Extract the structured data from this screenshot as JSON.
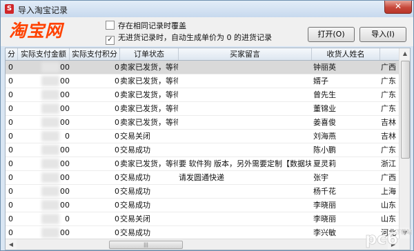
{
  "window": {
    "title": "导入淘宝记录",
    "app_icon": "S",
    "close_glyph": "✕"
  },
  "logo": {
    "text": "淘宝网"
  },
  "options": [
    {
      "label": "存在相同记录时覆盖",
      "checked": false
    },
    {
      "label": "无进货记录时，自动生成单价为 0 的进货记录",
      "checked": true
    }
  ],
  "buttons": {
    "open": "打开(O)",
    "import": "导入(I)"
  },
  "table": {
    "headers": [
      "分",
      "实际支付金额",
      "实际支付积分",
      "订单状态",
      "买家留言",
      "收货人姓名",
      ""
    ],
    "rows": [
      {
        "c0": "0",
        "amount": "00",
        "points": "0",
        "status": "卖家已发货，等待买",
        "message": "",
        "name": "钟丽英",
        "region": "广西",
        "selected": true
      },
      {
        "c0": "0",
        "amount": "00",
        "points": "0",
        "status": "卖家已发货，等待买",
        "message": "",
        "name": "婿子",
        "region": "广东",
        "selected": false
      },
      {
        "c0": "0",
        "amount": "00",
        "points": "0",
        "status": "卖家已发货，等待买",
        "message": "",
        "name": "曾先生",
        "region": "广东",
        "selected": false
      },
      {
        "c0": "0",
        "amount": "00",
        "points": "0",
        "status": "卖家已发货，等待买",
        "message": "",
        "name": "董锦业",
        "region": "广东",
        "selected": false
      },
      {
        "c0": "0",
        "amount": "00",
        "points": "0",
        "status": "卖家已发货，等待买",
        "message": "",
        "name": "姜喜俊",
        "region": "吉林",
        "selected": false
      },
      {
        "c0": "0",
        "amount": "0",
        "points": "0",
        "status": "交易关闭",
        "message": "",
        "name": "刘海燕",
        "region": "吉林",
        "selected": false
      },
      {
        "c0": "0",
        "amount": "00",
        "points": "0",
        "status": "交易成功",
        "message": "",
        "name": "陈小鹏",
        "region": "广东",
        "selected": false
      },
      {
        "c0": "0",
        "amount": "00",
        "points": "0",
        "status": "卖家已发货，等待买",
        "message": "要 软件狗 版本，另外需要定制【数据块",
        "name": "夏灵莉",
        "region": "浙江",
        "selected": false
      },
      {
        "c0": "0",
        "amount": "00",
        "points": "0",
        "status": "交易成功",
        "message": "请发圆通快递",
        "name": "张宇",
        "region": "广西",
        "selected": false
      },
      {
        "c0": "0",
        "amount": "00",
        "points": "0",
        "status": "交易成功",
        "message": "",
        "name": "杨千花",
        "region": "上海",
        "selected": false
      },
      {
        "c0": "0",
        "amount": "00",
        "points": "0",
        "status": "交易成功",
        "message": "",
        "name": "李晓丽",
        "region": "山东",
        "selected": false
      },
      {
        "c0": "0",
        "amount": "0",
        "points": "0",
        "status": "交易关闭",
        "message": "",
        "name": "李晓丽",
        "region": "山东",
        "selected": false
      },
      {
        "c0": "0",
        "amount": "00",
        "points": "0",
        "status": "交易成功",
        "message": "",
        "name": "李兴敏",
        "region": "河北",
        "selected": false
      }
    ]
  },
  "scrollbars": {
    "up": "▲",
    "down": "▼",
    "left": "◀",
    "right": "▶",
    "grip": "|||"
  },
  "watermark": {
    "text": "pc6",
    "sub": "下载站"
  }
}
